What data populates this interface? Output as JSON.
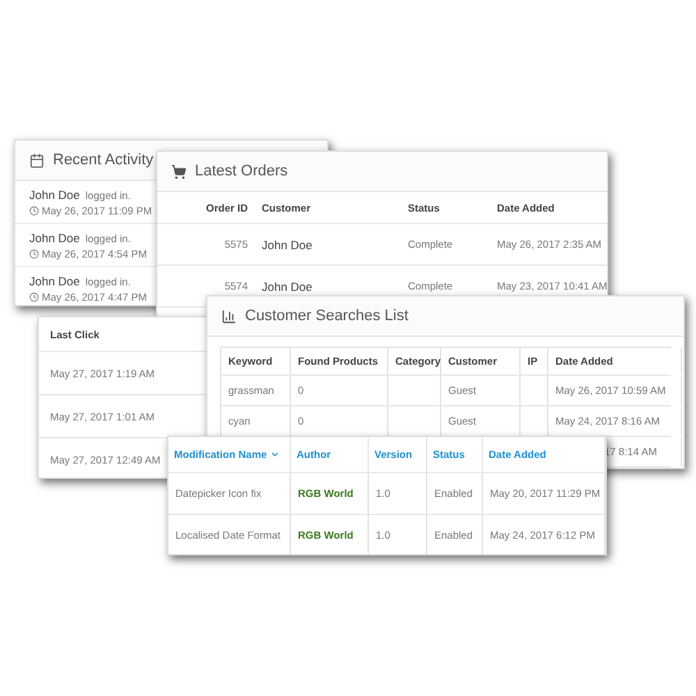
{
  "recent_activity": {
    "title": "Recent Activity",
    "items": [
      {
        "name": "John Doe",
        "action": "logged in.",
        "time": "May 26, 2017 11:09 PM"
      },
      {
        "name": "John Doe",
        "action": "logged in.",
        "time": "May 26, 2017 4:54 PM"
      },
      {
        "name": "John Doe",
        "action": "logged in.",
        "time": "May 26, 2017 4:47 PM"
      }
    ]
  },
  "latest_orders": {
    "title": "Latest Orders",
    "columns": [
      "Order ID",
      "Customer",
      "Status",
      "Date Added"
    ],
    "rows": [
      [
        "5575",
        "John Doe",
        "Complete",
        "May 26, 2017 2:35 AM"
      ],
      [
        "5574",
        "John Doe",
        "Complete",
        "May 23, 2017 10:41 AM"
      ]
    ]
  },
  "last_click": {
    "column": "Last Click",
    "rows": [
      "May 27, 2017 1:19 AM",
      "May 27, 2017 1:01 AM",
      "May 27, 2017 12:49 AM"
    ]
  },
  "customer_searches": {
    "title": "Customer Searches List",
    "columns": [
      "Keyword",
      "Found Products",
      "Category",
      "Customer",
      "IP",
      "Date Added"
    ],
    "rows": [
      [
        "grassman",
        "0",
        "",
        "Guest",
        "",
        "May 26, 2017 10:59 AM"
      ],
      [
        "cyan",
        "0",
        "",
        "Guest",
        "",
        "May 24, 2017 8:16 AM"
      ]
    ],
    "partial_row_date": "17 8:14 AM"
  },
  "modifications": {
    "columns": [
      {
        "label": "Modification Name",
        "sorted": true
      },
      {
        "label": "Author",
        "sorted": false
      },
      {
        "label": "Version",
        "sorted": false
      },
      {
        "label": "Status",
        "sorted": false
      },
      {
        "label": "Date Added",
        "sorted": false
      }
    ],
    "rows": [
      [
        "Datepicker Icon fix",
        "RGB World",
        "1.0",
        "Enabled",
        "May 20, 2017 11:29 PM"
      ],
      [
        "Localised Date Format",
        "RGB World",
        "1.0",
        "Enabled",
        "May 24, 2017 6:12 PM"
      ]
    ]
  }
}
